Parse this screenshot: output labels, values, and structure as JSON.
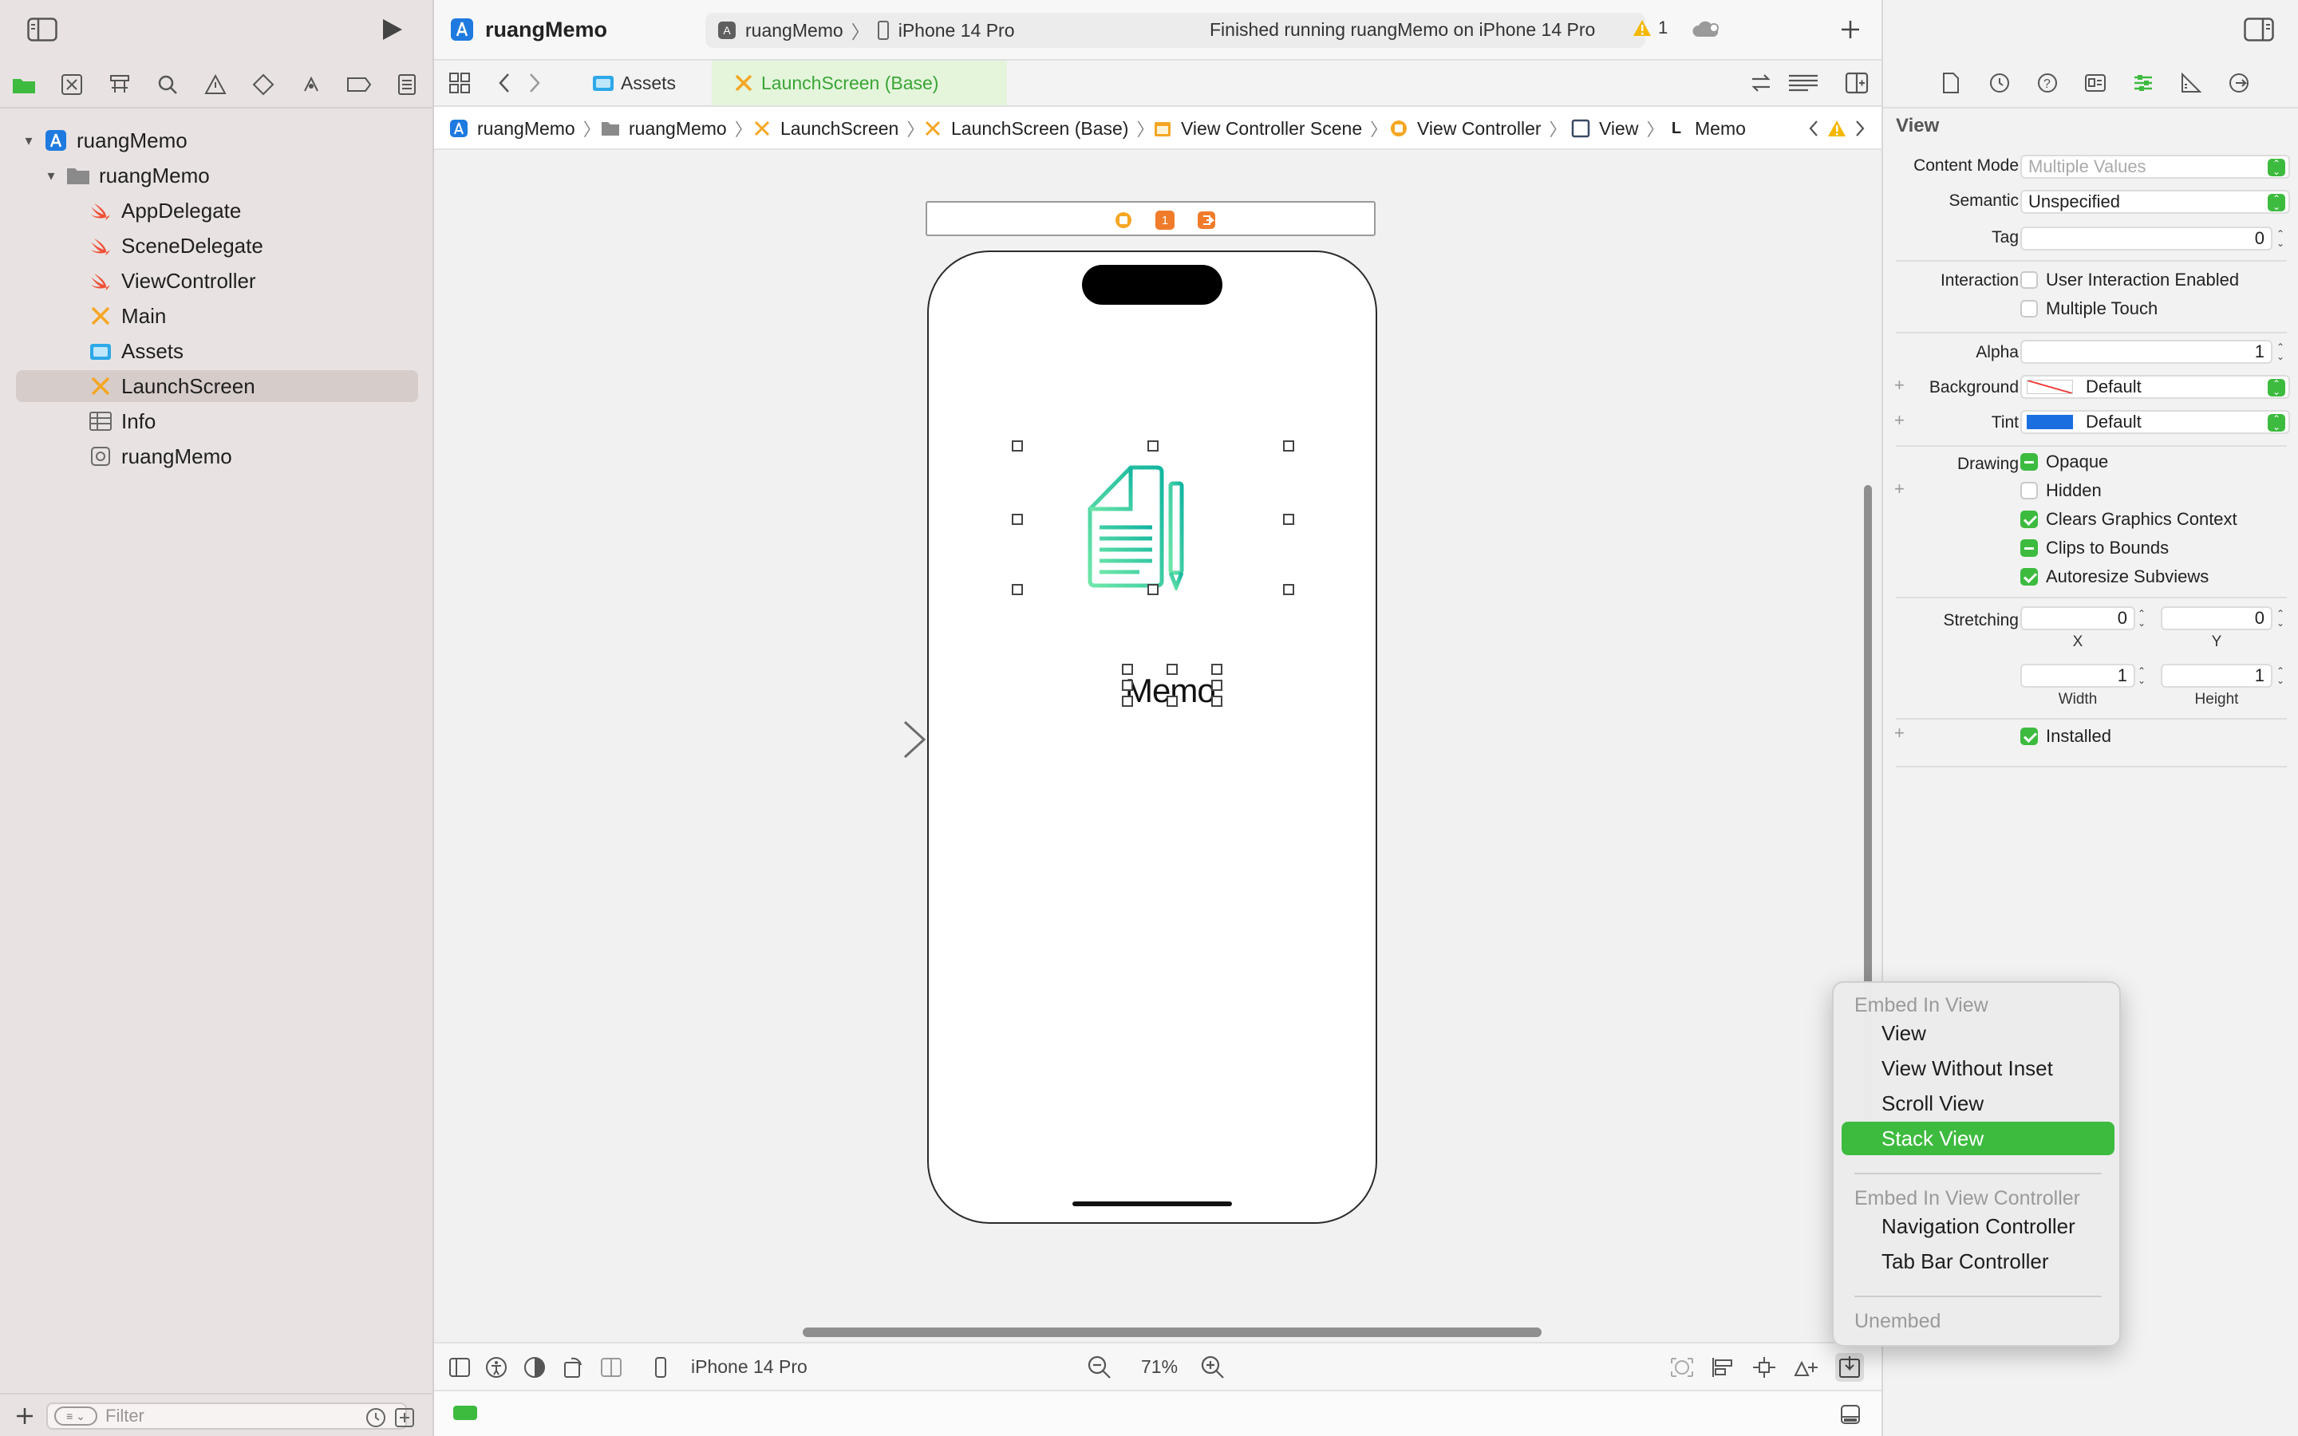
{
  "navigator": {
    "filter_placeholder": "Filter",
    "tree": [
      {
        "label": "ruangMemo",
        "icon": "xcode-project-icon",
        "level": 0
      },
      {
        "label": "ruangMemo",
        "icon": "folder-icon",
        "level": 1
      },
      {
        "label": "AppDelegate",
        "icon": "swift-file-icon",
        "level": 2
      },
      {
        "label": "SceneDelegate",
        "icon": "swift-file-icon",
        "level": 2
      },
      {
        "label": "ViewController",
        "icon": "swift-file-icon",
        "level": 2
      },
      {
        "label": "Main",
        "icon": "storyboard-icon",
        "level": 2
      },
      {
        "label": "Assets",
        "icon": "asset-catalog-icon",
        "level": 2
      },
      {
        "label": "LaunchScreen",
        "icon": "storyboard-icon",
        "level": 2,
        "selected": true
      },
      {
        "label": "Info",
        "icon": "plist-icon",
        "level": 2
      },
      {
        "label": "ruangMemo",
        "icon": "entitlements-icon",
        "level": 2
      }
    ]
  },
  "toolbar": {
    "project_title": "ruangMemo",
    "scheme": "ruangMemo",
    "device": "iPhone 14 Pro",
    "status": "Finished running ruangMemo on iPhone 14 Pro",
    "warning_count": "1"
  },
  "tabs": [
    {
      "label": "Assets",
      "icon": "asset-catalog-icon",
      "active": false
    },
    {
      "label": "LaunchScreen (Base)",
      "icon": "storyboard-icon",
      "active": true
    }
  ],
  "jumpbar": [
    {
      "label": "ruangMemo",
      "icon": "xcode-project-icon"
    },
    {
      "label": "ruangMemo",
      "icon": "folder-icon"
    },
    {
      "label": "LaunchScreen",
      "icon": "storyboard-icon"
    },
    {
      "label": "LaunchScreen (Base)",
      "icon": "storyboard-icon"
    },
    {
      "label": "View Controller Scene",
      "icon": "scene-icon"
    },
    {
      "label": "View Controller",
      "icon": "view-controller-icon"
    },
    {
      "label": "View",
      "icon": "view-icon"
    },
    {
      "label": "Memo",
      "icon": "label-icon"
    }
  ],
  "canvas": {
    "memo_label": "Memo",
    "scene_dock_badge": "1",
    "device_name": "iPhone 14 Pro",
    "zoom": "71%"
  },
  "inspector": {
    "section_title": "View",
    "content_mode_label": "Content Mode",
    "content_mode_value": "Multiple Values",
    "semantic_label": "Semantic",
    "semantic_value": "Unspecified",
    "tag_label": "Tag",
    "tag_value": "0",
    "interaction_label": "Interaction",
    "user_interaction": "User Interaction Enabled",
    "multiple_touch": "Multiple Touch",
    "alpha_label": "Alpha",
    "alpha_value": "1",
    "background_label": "Background",
    "background_value": "Default",
    "tint_label": "Tint",
    "tint_value": "Default",
    "tint_color": "#1a6ee0",
    "drawing_label": "Drawing",
    "opaque": "Opaque",
    "hidden": "Hidden",
    "clears_graphics": "Clears Graphics Context",
    "clips_to_bounds": "Clips to Bounds",
    "autoresize": "Autoresize Subviews",
    "stretching_label": "Stretching",
    "stretch_x": "0",
    "stretch_y": "0",
    "stretch_w": "1",
    "stretch_h": "1",
    "x_label": "X",
    "y_label": "Y",
    "width_label": "Width",
    "height_label": "Height",
    "installed": "Installed"
  },
  "menu": {
    "header1": "Embed In View",
    "items1": [
      "View",
      "View Without Inset",
      "Scroll View",
      "Stack View"
    ],
    "header2": "Embed In View Controller",
    "items2": [
      "Navigation Controller",
      "Tab Bar Controller"
    ],
    "unembed": "Unembed",
    "active_color": "#3dbb3f"
  }
}
